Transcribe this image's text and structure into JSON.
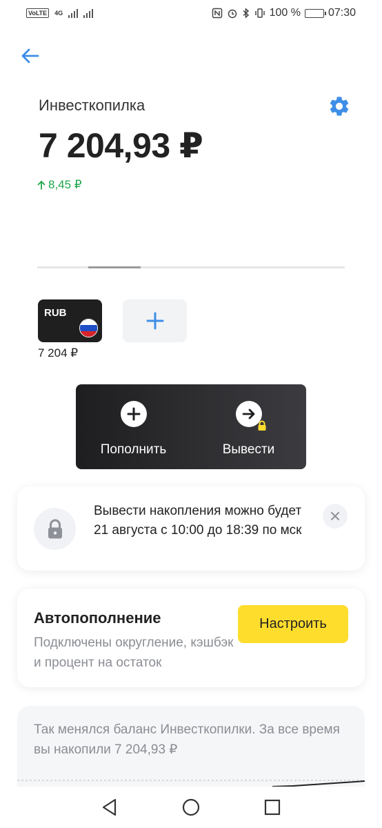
{
  "status_bar": {
    "volte": "VoLTE",
    "network": "4G",
    "battery": "100 %",
    "time": "07:30"
  },
  "header": {
    "title": "Инвесткопилка",
    "balance": "7 204,93 ₽",
    "change": "8,45 ₽"
  },
  "currencies": [
    {
      "code": "RUB",
      "amount": "7 204 ₽"
    }
  ],
  "actions": {
    "top_up": "Пополнить",
    "withdraw": "Вывести"
  },
  "notice": {
    "text": "Вывести накопления можно будет 21 августа с 10:00 до 18:39 по мск"
  },
  "auto_topup": {
    "title": "Автопополнение",
    "description": "Подключены округление, кэшбэк и процент на остаток",
    "button": "Настроить"
  },
  "history": {
    "text": "Так менялся баланс Инвесткопилки. За все время вы накопили 7 204,93 ₽"
  },
  "colors": {
    "accent_blue": "#3e8ee8",
    "positive_green": "#1ea64a",
    "button_yellow": "#ffdd2d",
    "dark_panel": "#1e1e20"
  }
}
